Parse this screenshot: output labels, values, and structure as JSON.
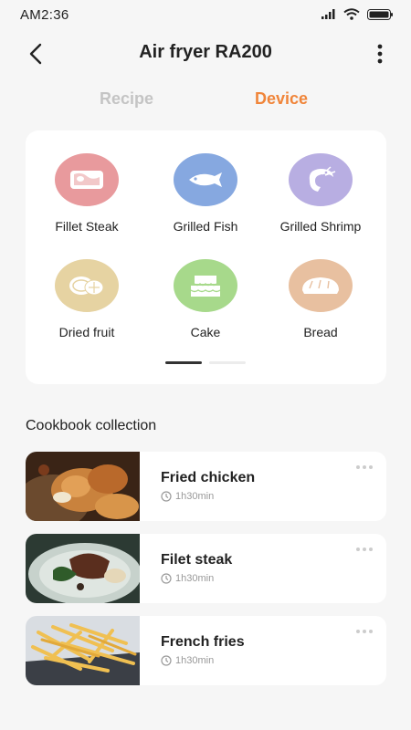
{
  "status_bar": {
    "time": "AM2:36"
  },
  "header": {
    "title": "Air fryer RA200"
  },
  "tabs": [
    {
      "label": "Recipe",
      "active": false
    },
    {
      "label": "Device",
      "active": true
    }
  ],
  "colors": {
    "accent": "#f0853a",
    "inactive_tab": "#c4c4c4"
  },
  "categories": [
    {
      "label": "Fillet Steak",
      "icon": "steak-icon",
      "color": "#e89a9d"
    },
    {
      "label": "Grilled Fish",
      "icon": "fish-icon",
      "color": "#86a8e0"
    },
    {
      "label": "Grilled Shrimp",
      "icon": "shrimp-icon",
      "color": "#b8aee2"
    },
    {
      "label": "Dried fruit",
      "icon": "dried-fruit-icon",
      "color": "#e6d3a2"
    },
    {
      "label": "Cake",
      "icon": "cake-icon",
      "color": "#a7d98b"
    },
    {
      "label": "Bread",
      "icon": "bread-icon",
      "color": "#e8c0a0"
    }
  ],
  "pager": {
    "pages": 2,
    "current": 1
  },
  "cookbook": {
    "title": "Cookbook collection",
    "items": [
      {
        "name": "Fried chicken",
        "time": "1h30min",
        "icon": "clock-icon"
      },
      {
        "name": "Filet steak",
        "time": "1h30min",
        "icon": "clock-icon"
      },
      {
        "name": "French fries",
        "time": "1h30min",
        "icon": "clock-icon"
      }
    ]
  }
}
